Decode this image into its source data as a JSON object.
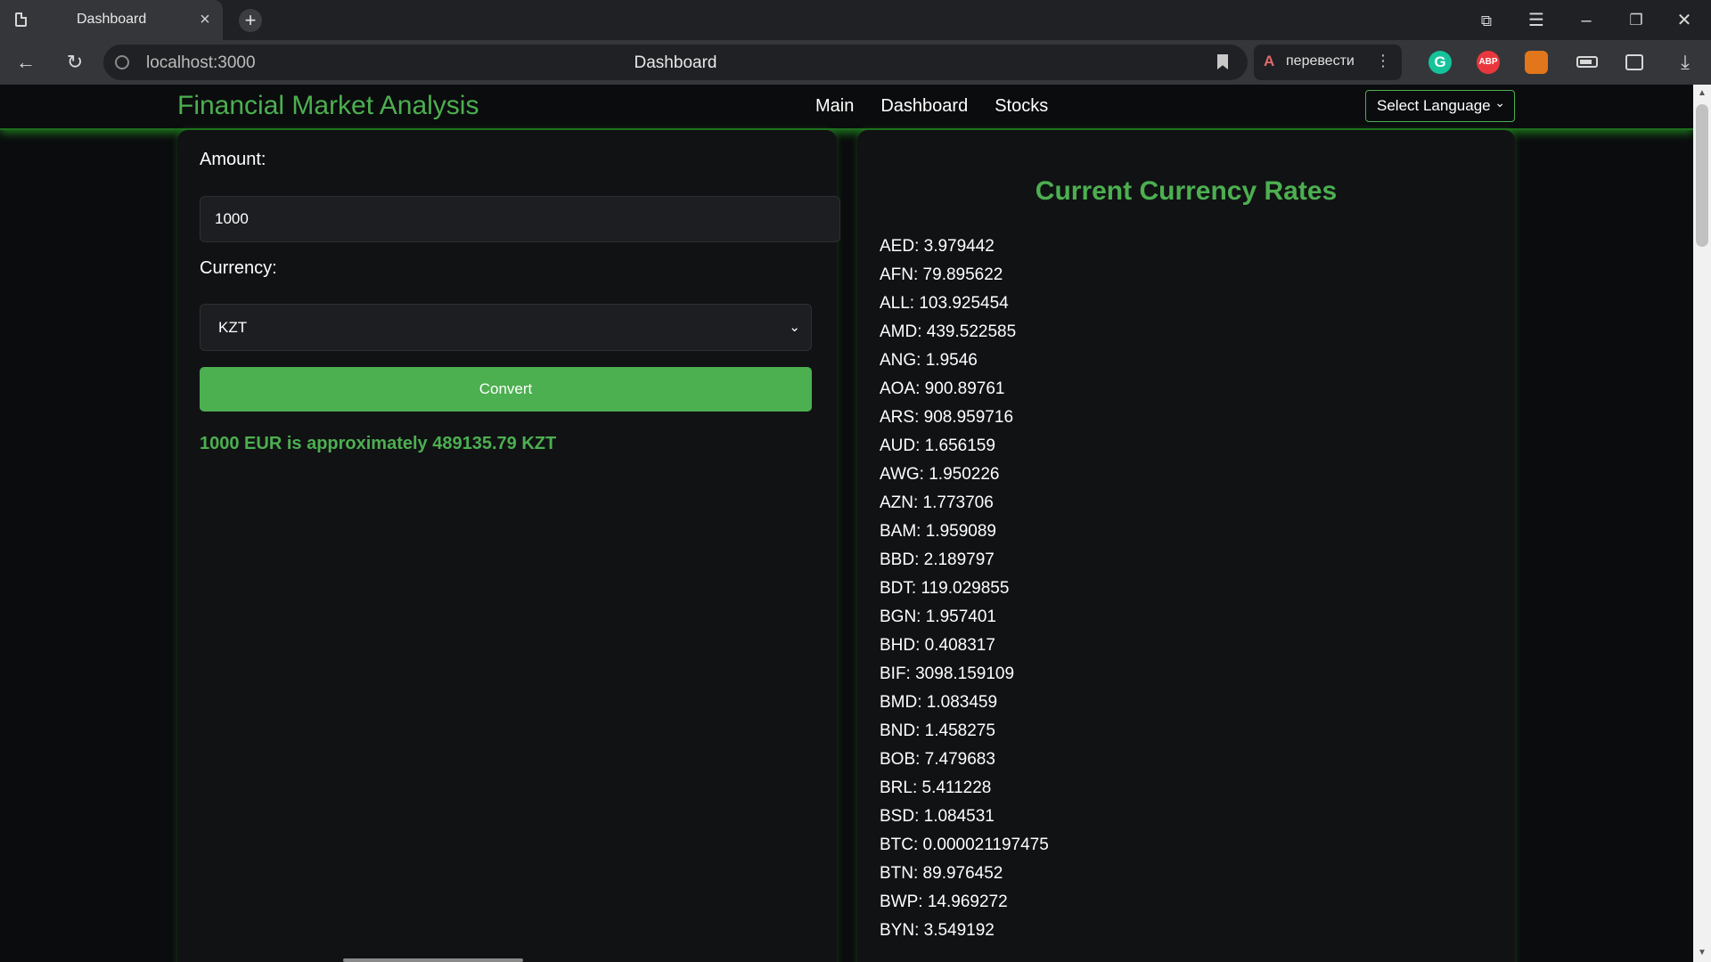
{
  "browser": {
    "tab_title": "Dashboard",
    "tab_close": "×",
    "new_tab": "+",
    "url": "localhost:3000",
    "page_title": "Dashboard",
    "translate_label": "перевести",
    "translate_glyph": "A",
    "translate_more": "⋮",
    "grammarly_letter": "G",
    "abp_label": "ABP",
    "back_glyph": "←",
    "reload_glyph": "↻",
    "minimize_glyph": "–",
    "maximize_glyph": "❐",
    "close_glyph": "✕",
    "menu_glyph": "☰",
    "download_glyph": "⤓"
  },
  "navbar": {
    "brand": "Financial Market Analysis",
    "links": [
      "Main",
      "Dashboard",
      "Stocks"
    ],
    "language_select": "Select Language",
    "chevron": "⌄"
  },
  "converter": {
    "amount_label": "Amount:",
    "amount_value": "1000",
    "currency_label": "Currency:",
    "currency_value": "KZT",
    "convert_label": "Convert",
    "result_text": "1000 EUR is approximately 489135.79 KZT"
  },
  "rates": {
    "title": "Current Currency Rates",
    "items": [
      "AED: 3.979442",
      "AFN: 79.895622",
      "ALL: 103.925454",
      "AMD: 439.522585",
      "ANG: 1.9546",
      "AOA: 900.89761",
      "ARS: 908.959716",
      "AUD: 1.656159",
      "AWG: 1.950226",
      "AZN: 1.773706",
      "BAM: 1.959089",
      "BBD: 2.189797",
      "BDT: 119.029855",
      "BGN: 1.957401",
      "BHD: 0.408317",
      "BIF: 3098.159109",
      "BMD: 1.083459",
      "BND: 1.458275",
      "BOB: 7.479683",
      "BRL: 5.411228",
      "BSD: 1.084531",
      "BTC: 0.000021197475",
      "BTN: 89.976452",
      "BWP: 14.969272",
      "BYN: 3.549192"
    ]
  },
  "colors": {
    "accent": "#4caf50",
    "background": "#0b0c0e",
    "panel": "#111214"
  },
  "icons": [
    "page-icon",
    "back-icon",
    "reload-icon",
    "site-info-icon",
    "bookmark-icon",
    "translate-icon",
    "grammarly-icon",
    "adblock-icon",
    "fox-extension-icon",
    "battery-icon",
    "reader-icon",
    "download-icon"
  ]
}
